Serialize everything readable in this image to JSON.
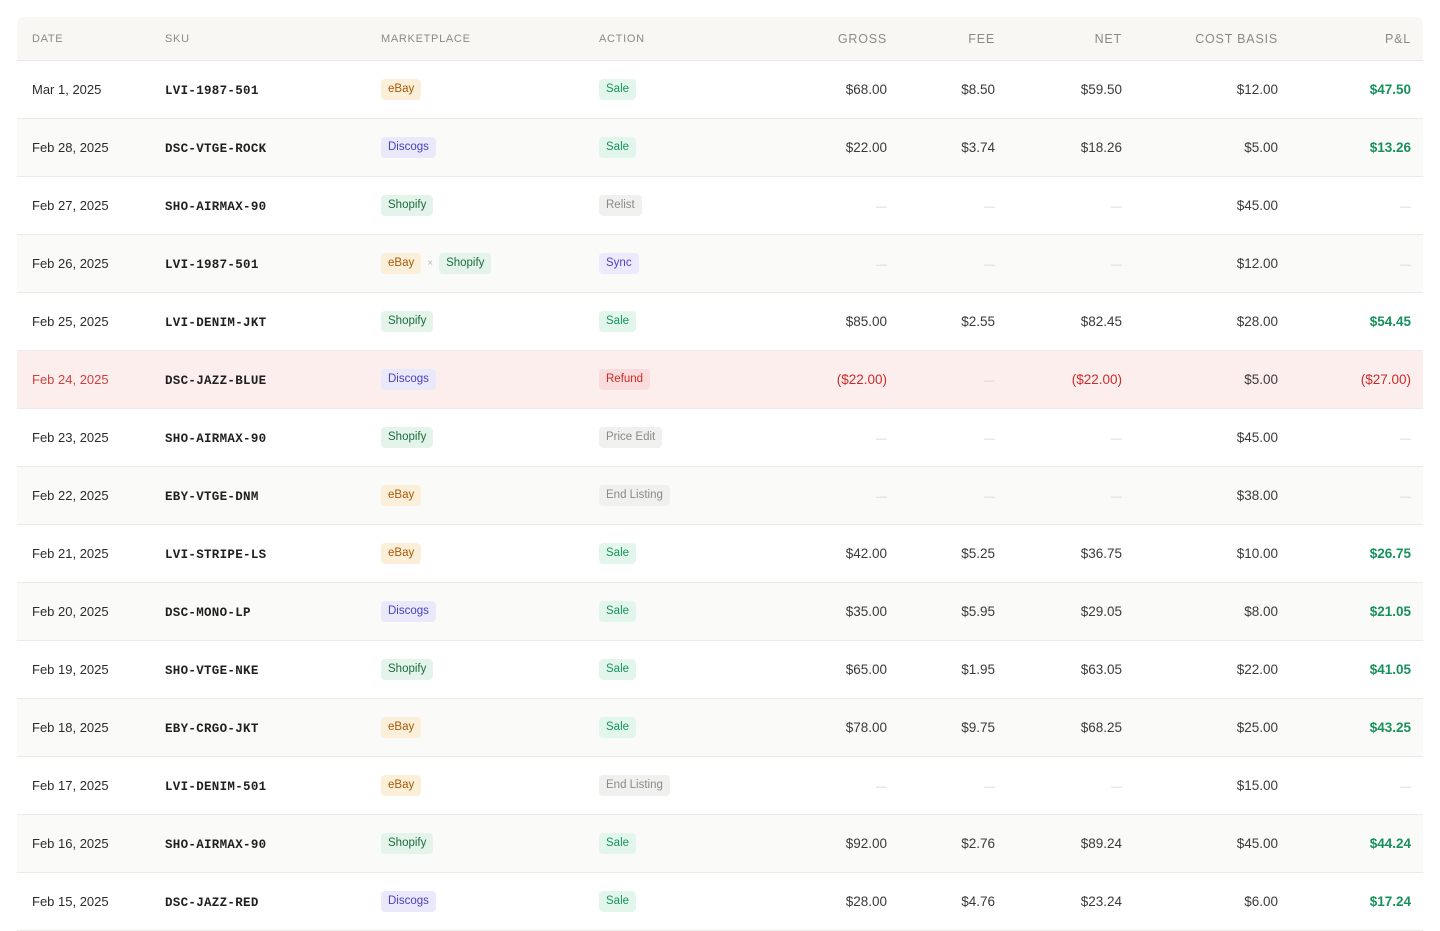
{
  "columns": {
    "date": "DATE",
    "sku": "SKU",
    "marketplace": "MARKETPLACE",
    "action": "ACTION",
    "gross": "GROSS",
    "fee": "FEE",
    "net": "NET",
    "cost_basis": "COST BASIS",
    "pl": "P&L"
  },
  "empty_value": "—",
  "marketplace_separator": "×",
  "marketplace_colors": {
    "eBay": "#a65a07",
    "Shopify": "#1c6b3d",
    "Discogs": "#4b41b8"
  },
  "action_colors": {
    "Sale": "#17915c",
    "Refund": "#cc2a2a",
    "Sync": "#5140c4",
    "muted": "#8a8a86"
  },
  "positive_color": "#17915c",
  "negative_color": "#cc2a2a",
  "rows": [
    {
      "date": "Mar 1, 2025",
      "sku": "LVI-1987-501",
      "marketplaces": [
        "eBay"
      ],
      "action": "Sale",
      "gross": "$68.00",
      "fee": "$8.50",
      "net": "$59.50",
      "cost_basis": "$12.00",
      "pl": "$47.50"
    },
    {
      "date": "Feb 28, 2025",
      "sku": "DSC-VTGE-ROCK",
      "marketplaces": [
        "Discogs"
      ],
      "action": "Sale",
      "gross": "$22.00",
      "fee": "$3.74",
      "net": "$18.26",
      "cost_basis": "$5.00",
      "pl": "$13.26"
    },
    {
      "date": "Feb 27, 2025",
      "sku": "SHO-AIRMAX-90",
      "marketplaces": [
        "Shopify"
      ],
      "action": "Relist",
      "gross": null,
      "fee": null,
      "net": null,
      "cost_basis": "$45.00",
      "pl": null
    },
    {
      "date": "Feb 26, 2025",
      "sku": "LVI-1987-501",
      "marketplaces": [
        "eBay",
        "Shopify"
      ],
      "action": "Sync",
      "gross": null,
      "fee": null,
      "net": null,
      "cost_basis": "$12.00",
      "pl": null
    },
    {
      "date": "Feb 25, 2025",
      "sku": "LVI-DENIM-JKT",
      "marketplaces": [
        "Shopify"
      ],
      "action": "Sale",
      "gross": "$85.00",
      "fee": "$2.55",
      "net": "$82.45",
      "cost_basis": "$28.00",
      "pl": "$54.45"
    },
    {
      "date": "Feb 24, 2025",
      "sku": "DSC-JAZZ-BLUE",
      "marketplaces": [
        "Discogs"
      ],
      "action": "Refund",
      "gross": "($22.00)",
      "fee": null,
      "net": "($22.00)",
      "cost_basis": "$5.00",
      "pl": "($27.00)"
    },
    {
      "date": "Feb 23, 2025",
      "sku": "SHO-AIRMAX-90",
      "marketplaces": [
        "Shopify"
      ],
      "action": "Price Edit",
      "gross": null,
      "fee": null,
      "net": null,
      "cost_basis": "$45.00",
      "pl": null
    },
    {
      "date": "Feb 22, 2025",
      "sku": "EBY-VTGE-DNM",
      "marketplaces": [
        "eBay"
      ],
      "action": "End Listing",
      "gross": null,
      "fee": null,
      "net": null,
      "cost_basis": "$38.00",
      "pl": null
    },
    {
      "date": "Feb 21, 2025",
      "sku": "LVI-STRIPE-LS",
      "marketplaces": [
        "eBay"
      ],
      "action": "Sale",
      "gross": "$42.00",
      "fee": "$5.25",
      "net": "$36.75",
      "cost_basis": "$10.00",
      "pl": "$26.75"
    },
    {
      "date": "Feb 20, 2025",
      "sku": "DSC-MONO-LP",
      "marketplaces": [
        "Discogs"
      ],
      "action": "Sale",
      "gross": "$35.00",
      "fee": "$5.95",
      "net": "$29.05",
      "cost_basis": "$8.00",
      "pl": "$21.05"
    },
    {
      "date": "Feb 19, 2025",
      "sku": "SHO-VTGE-NKE",
      "marketplaces": [
        "Shopify"
      ],
      "action": "Sale",
      "gross": "$65.00",
      "fee": "$1.95",
      "net": "$63.05",
      "cost_basis": "$22.00",
      "pl": "$41.05"
    },
    {
      "date": "Feb 18, 2025",
      "sku": "EBY-CRGO-JKT",
      "marketplaces": [
        "eBay"
      ],
      "action": "Sale",
      "gross": "$78.00",
      "fee": "$9.75",
      "net": "$68.25",
      "cost_basis": "$25.00",
      "pl": "$43.25"
    },
    {
      "date": "Feb 17, 2025",
      "sku": "LVI-DENIM-501",
      "marketplaces": [
        "eBay"
      ],
      "action": "End Listing",
      "gross": null,
      "fee": null,
      "net": null,
      "cost_basis": "$15.00",
      "pl": null
    },
    {
      "date": "Feb 16, 2025",
      "sku": "SHO-AIRMAX-90",
      "marketplaces": [
        "Shopify"
      ],
      "action": "Sale",
      "gross": "$92.00",
      "fee": "$2.76",
      "net": "$89.24",
      "cost_basis": "$45.00",
      "pl": "$44.24"
    },
    {
      "date": "Feb 15, 2025",
      "sku": "DSC-JAZZ-RED",
      "marketplaces": [
        "Discogs"
      ],
      "action": "Sale",
      "gross": "$28.00",
      "fee": "$4.76",
      "net": "$23.24",
      "cost_basis": "$6.00",
      "pl": "$17.24"
    }
  ]
}
